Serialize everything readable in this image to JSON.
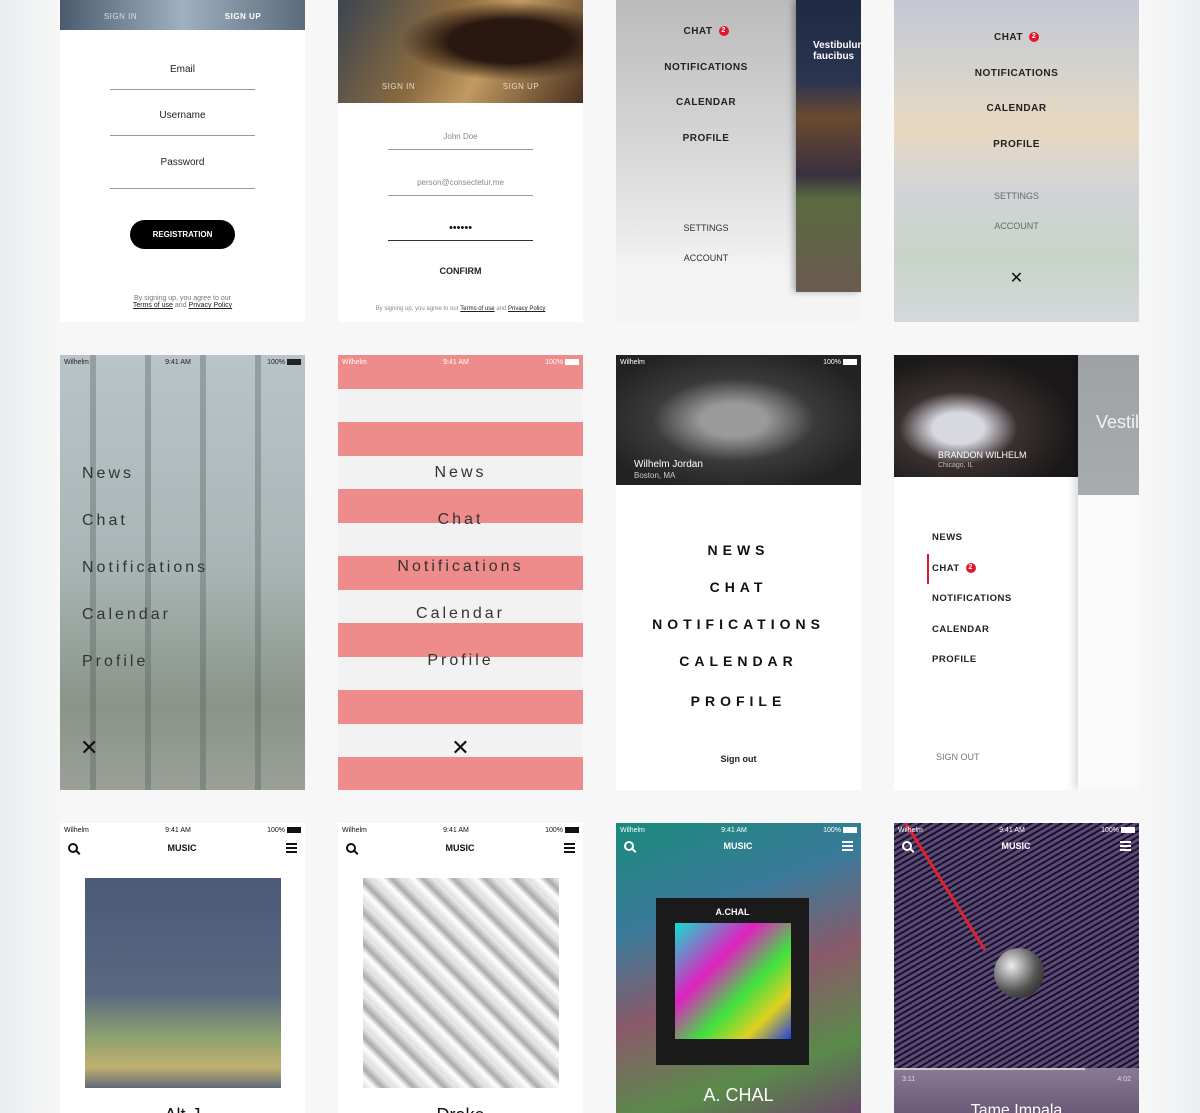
{
  "signup_light": {
    "tab_sign_in": "SIGN IN",
    "tab_sign_up": "SIGN UP",
    "email": "Email",
    "username": "Username",
    "password": "Password",
    "register": "REGISTRATION",
    "terms_prefix": "By signing up, you agree to our",
    "terms": "Terms of use",
    "and": "and",
    "privacy": "Privacy Policy"
  },
  "signup_photo": {
    "tab_sign_in": "SIGN IN",
    "tab_sign_up": "SIGN UP",
    "name": "John Doe",
    "email": "person@consectetur.me",
    "password": "••••••",
    "confirm": "CONFIRM",
    "terms_prefix": "By signing up, you agree to our",
    "terms": "Terms of use",
    "and": "and",
    "privacy": "Privacy Policy"
  },
  "menu_city": {
    "items": [
      "CHAT",
      "NOTIFICATIONS",
      "CALENDAR",
      "PROFILE"
    ],
    "chat_badge": "2",
    "secondary": [
      "SETTINGS",
      "ACCOUNT"
    ],
    "peek_title": "Vestibulum faucibus"
  },
  "menu_blur": {
    "items": [
      "CHAT",
      "NOTIFICATIONS",
      "CALENDAR",
      "PROFILE"
    ],
    "chat_badge": "2",
    "secondary": [
      "SETTINGS",
      "ACCOUNT"
    ]
  },
  "status": {
    "carrier": "Wilhelm",
    "time": "9:41 AM",
    "battery": "100%"
  },
  "menu_forest": {
    "items": [
      "News",
      "Chat",
      "Notifications",
      "Calendar",
      "Profile"
    ]
  },
  "menu_stripes": {
    "items": [
      "News",
      "Chat",
      "Notifications",
      "Calendar",
      "Profile"
    ]
  },
  "menu_profile": {
    "name": "Wilhelm Jordan",
    "location": "Boston, MA",
    "items": [
      "NEWS",
      "CHAT",
      "NOTIFICATIONS",
      "CALENDAR",
      "PROFILE"
    ],
    "sign_out": "Sign out"
  },
  "menu_sidebar": {
    "name": "BRANDON WILHELM",
    "location": "Chicago, IL",
    "items": [
      "NEWS",
      "CHAT",
      "NOTIFICATIONS",
      "CALENDAR",
      "PROFILE"
    ],
    "chat_badge": "2",
    "sign_out": "SIGN OUT",
    "peek_title": "Vestibulum primis luctus"
  },
  "music": {
    "title": "MUSIC",
    "albums": [
      "Alt-J",
      "Drake",
      "A. CHAL",
      "Tame Impala"
    ],
    "cover_label": "A.CHAL",
    "time_elapsed": "3:11",
    "time_total": "4:02"
  },
  "colors": {
    "accent": "#e0182d",
    "stripe": "#ee8c8c"
  }
}
